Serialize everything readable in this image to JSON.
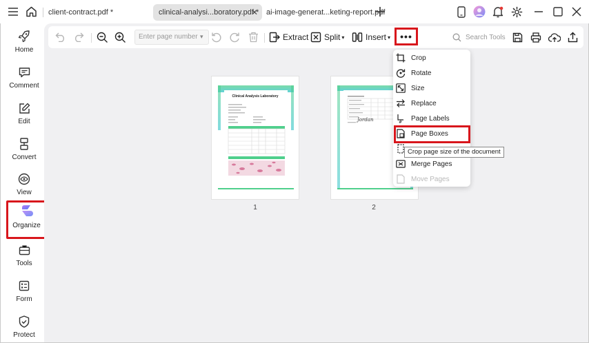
{
  "titlebar": {
    "tabs": [
      {
        "label": "client-contract.pdf *",
        "active": false
      },
      {
        "label": "clinical-analysi...boratory.pdf *",
        "active": true
      },
      {
        "label": "ai-image-generat...keting-report.pdf",
        "active": false
      }
    ],
    "icons": [
      "menu-icon",
      "home-icon",
      "close-icon",
      "add-tab-icon",
      "phone-icon",
      "avatar-icon",
      "bell-icon",
      "settings-icon",
      "minimize-icon",
      "maximize-icon",
      "window-close-icon"
    ]
  },
  "sidebar": {
    "items": [
      {
        "label": "Home",
        "icon": "rocket-icon"
      },
      {
        "label": "Comment",
        "icon": "comment-icon"
      },
      {
        "label": "Edit",
        "icon": "edit-icon"
      },
      {
        "label": "Convert",
        "icon": "convert-icon"
      },
      {
        "label": "View",
        "icon": "view-icon"
      },
      {
        "label": "Organize",
        "icon": "organize-icon",
        "active": true
      },
      {
        "label": "Tools",
        "icon": "tools-icon"
      },
      {
        "label": "Form",
        "icon": "form-icon"
      },
      {
        "label": "Protect",
        "icon": "protect-icon"
      }
    ]
  },
  "toolbar": {
    "page_input_placeholder": "Enter page number",
    "extract_label": "Extract",
    "split_label": "Split",
    "insert_label": "Insert",
    "more_label": "•••",
    "search_placeholder": "Search Tools"
  },
  "pages": [
    {
      "number": "1",
      "title": "Clinical Analysis Laboratory"
    },
    {
      "number": "2",
      "signature": "Jordan"
    }
  ],
  "menu": {
    "items": [
      {
        "label": "Crop",
        "icon": "crop-icon",
        "enabled": true
      },
      {
        "label": "Rotate",
        "icon": "rotate-icon",
        "enabled": true
      },
      {
        "label": "Size",
        "icon": "size-icon",
        "enabled": true
      },
      {
        "label": "Replace",
        "icon": "replace-icon",
        "enabled": true
      },
      {
        "label": "Page Labels",
        "icon": "page-labels-icon",
        "enabled": true
      },
      {
        "label": "Page Boxes",
        "icon": "page-boxes-icon",
        "enabled": true,
        "highlighted": true
      },
      {
        "label": "",
        "icon": "hidden-icon",
        "enabled": true
      },
      {
        "label": "Merge Pages",
        "icon": "merge-pages-icon",
        "enabled": true
      },
      {
        "label": "Move Pages",
        "icon": "move-pages-icon",
        "enabled": false
      }
    ],
    "tooltip": "Crop page size of the document"
  },
  "colors": {
    "highlight_red": "#d8161c",
    "accent_green": "#4fcf8c",
    "canvas_bg": "#f0f0f2"
  }
}
